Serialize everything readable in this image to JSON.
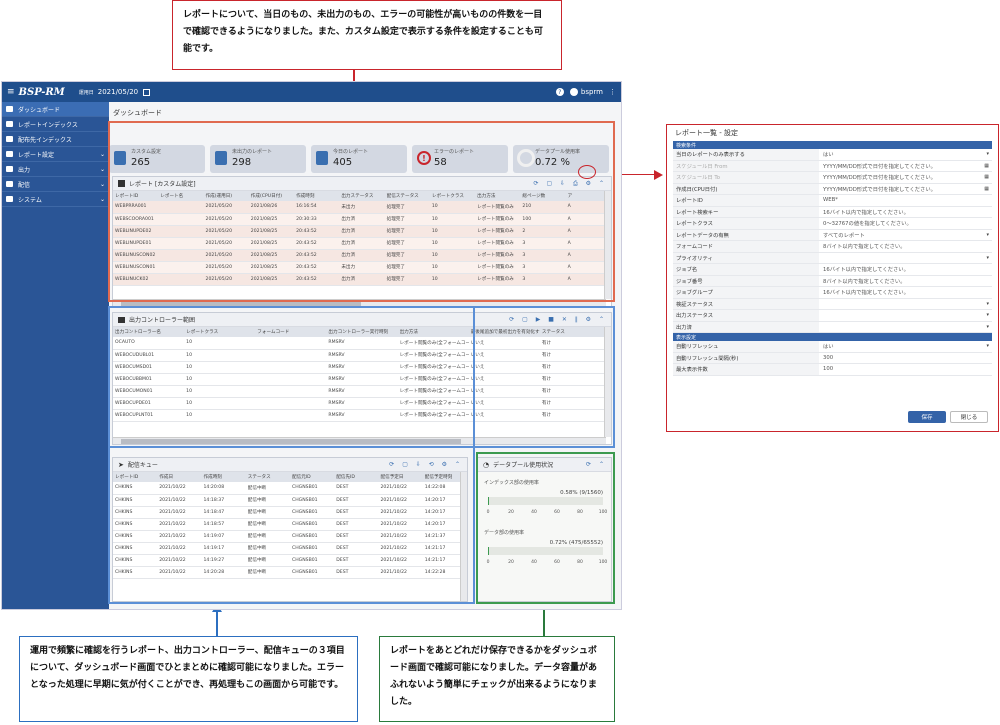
{
  "callouts": {
    "top": "レポートについて、当日のもの、未出力のもの、エラーの可能性が高いものの件数を一目で確認できるようになりました。また、カスタム設定で表示する条件を設定することも可能です。",
    "left": "運用で頻繁に確認を行うレポート、出力コントローラー、配信キューの３項目について、ダッシュボード画面でひとまとめに確認可能になりました。エラーとなった処理に早期に気が付くことができ、再処理もこの画面から可能です。",
    "right": "レポートをあとどれだけ保存できるかをダッシュボード画面で確認可能になりました。データ容量があふれないよう簡単にチェックが出来るようになりました。"
  },
  "app": {
    "logo": "BSP-RM",
    "date_label": "運用日",
    "date": "2021/05/20",
    "user": "bsprm",
    "page_title": "ダッシュボード"
  },
  "sidebar": {
    "items": [
      {
        "label": "ダッシュボード",
        "icon": "dashboard-icon"
      },
      {
        "label": "レポートインデックス",
        "icon": "report-icon"
      },
      {
        "label": "配布先インデックス",
        "icon": "book-icon"
      },
      {
        "label": "レポート設定",
        "icon": "list-icon"
      },
      {
        "label": "出力",
        "icon": "printer-icon"
      },
      {
        "label": "配信",
        "icon": "send-icon"
      },
      {
        "label": "システム",
        "icon": "monitor-icon"
      }
    ]
  },
  "cards": [
    {
      "label": "カスタム設定",
      "value": "265"
    },
    {
      "label": "未出力のレポート",
      "value": "298"
    },
    {
      "label": "今日のレポート",
      "value": "405"
    },
    {
      "label": "エラーのレポート",
      "value": "58"
    },
    {
      "label": "データプール使用率",
      "value": "0.72 %"
    }
  ],
  "report_panel": {
    "title": "レポート [カスタム設定]",
    "headers": [
      "レポートID",
      "レポート名",
      "作成(運用日)",
      "作成(CPU日付)",
      "作成時刻",
      "出力ステータス",
      "配信ステータス",
      "レポートクラス",
      "出力方法",
      "総ページ数",
      "ア"
    ],
    "rows": [
      [
        "WEBPRRA001",
        "",
        "2021/05/20",
        "2021/08/26",
        "16:16:54",
        "未出力",
        "処理完了",
        "10",
        "レポート閲覧のみ",
        "210",
        "A"
      ],
      [
        "WEBSCOORA001",
        "",
        "2021/05/20",
        "2021/08/25",
        "20:30:33",
        "出力済",
        "処理完了",
        "10",
        "レポート閲覧のみ",
        "100",
        "A"
      ],
      [
        "WEBLINUPDE02",
        "",
        "2021/05/20",
        "2021/08/25",
        "20:43:52",
        "出力済",
        "処理完了",
        "10",
        "レポート閲覧のみ",
        "2",
        "A"
      ],
      [
        "WEBLINUPDE01",
        "",
        "2021/05/20",
        "2021/08/25",
        "20:43:52",
        "出力済",
        "処理完了",
        "10",
        "レポート閲覧のみ",
        "3",
        "A"
      ],
      [
        "WEBLINUSCON02",
        "",
        "2021/05/20",
        "2021/08/25",
        "20:43:52",
        "出力済",
        "処理完了",
        "10",
        "レポート閲覧のみ",
        "3",
        "A"
      ],
      [
        "WEBLINUSCON01",
        "",
        "2021/05/20",
        "2021/08/25",
        "20:43:52",
        "未出力",
        "処理完了",
        "10",
        "レポート閲覧のみ",
        "3",
        "A"
      ],
      [
        "WEBLINUCK02",
        "",
        "2021/05/20",
        "2021/08/25",
        "20:43:52",
        "出力済",
        "処理完了",
        "10",
        "レポート閲覧のみ",
        "3",
        "A"
      ]
    ]
  },
  "output_panel": {
    "title": "出力コントローラー範囲",
    "headers": [
      "出力コントローラー名",
      "レポートクラス",
      "フォームコード",
      "出力コントローラー実行時刻",
      "出力方法",
      "最後尾追加で最初出力を有効化する",
      "ステータス"
    ],
    "rows": [
      [
        "OCAUTO",
        "10",
        "",
        "RMSRV",
        "レポート閲覧のみ(全フォームコード対象)",
        "いいえ",
        "有け"
      ],
      [
        "WEBOCUDUBL01",
        "10",
        "",
        "RMSRV",
        "レポート閲覧のみ(全フォームコード対象)",
        "いいえ",
        "有け"
      ],
      [
        "WEBOCUMSD01",
        "10",
        "",
        "RMSRV",
        "レポート閲覧のみ(全フォームコード対象)",
        "いいえ",
        "有け"
      ],
      [
        "WEBOCUBBM01",
        "10",
        "",
        "RMSRV",
        "レポート閲覧のみ(全フォームコード対象)",
        "いいえ",
        "有け"
      ],
      [
        "WEBOCUMON01",
        "10",
        "",
        "RMSRV",
        "レポート閲覧のみ(全フォームコード対象)",
        "いいえ",
        "有け"
      ],
      [
        "WEBOCUPDE01",
        "10",
        "",
        "RMSRV",
        "レポート閲覧のみ(全フォームコード対象)",
        "いいえ",
        "有け"
      ],
      [
        "WEBOCUPLNT01",
        "10",
        "",
        "RMSRV",
        "レポート閲覧のみ(全フォームコード対象)",
        "いいえ",
        "有け"
      ]
    ]
  },
  "queue_panel": {
    "title": "配信キュー",
    "headers": [
      "レポートID",
      "作成日",
      "作成時刻",
      "ステータス",
      "配信元ID",
      "配信先ID",
      "配信予定日",
      "配信予定時刻"
    ],
    "rows": [
      [
        "CHKINS",
        "2021/10/22",
        "14:20:08",
        "配信中断",
        "CHGNSB01",
        "DEST",
        "2021/10/22",
        "14:22:08"
      ],
      [
        "CHKINS",
        "2021/10/22",
        "14:18:37",
        "配信中断",
        "CHGNSB01",
        "DEST",
        "2021/10/22",
        "14:20:17"
      ],
      [
        "CHKINS",
        "2021/10/22",
        "14:18:47",
        "配信中断",
        "CHGNSB01",
        "DEST",
        "2021/10/22",
        "14:20:17"
      ],
      [
        "CHKINS",
        "2021/10/22",
        "14:18:57",
        "配信中断",
        "CHGNSB01",
        "DEST",
        "2021/10/22",
        "14:20:17"
      ],
      [
        "CHKINS",
        "2021/10/22",
        "14:19:07",
        "配信中断",
        "CHGNSB01",
        "DEST",
        "2021/10/22",
        "14:21:37"
      ],
      [
        "CHKINS",
        "2021/10/22",
        "14:19:17",
        "配信中断",
        "CHGNSB01",
        "DEST",
        "2021/10/22",
        "14:21:17"
      ],
      [
        "CHKINS",
        "2021/10/22",
        "14:19:27",
        "配信中断",
        "CHGNSB01",
        "DEST",
        "2021/10/22",
        "14:21:17"
      ],
      [
        "CHKINS",
        "2021/10/22",
        "14:20:28",
        "配信中断",
        "CHGNSB01",
        "DEST",
        "2021/10/22",
        "14:22:28"
      ]
    ]
  },
  "pool_panel": {
    "title": "データプール使用状況",
    "axis_ticks": [
      "0",
      "20",
      "40",
      "60",
      "80",
      "100"
    ],
    "gauges": [
      {
        "label": "インデックス部の使用率",
        "value_text": "0.58% (9/1560)",
        "percent": 0.58
      },
      {
        "label": "データ部の使用率",
        "value_text": "0.72% (475/65552)",
        "percent": 0.72
      }
    ]
  },
  "dialog": {
    "title": "レポート一覧 - 設定",
    "section1": "検索条件",
    "section2": "表示設定",
    "rows1": [
      {
        "label": "当日のレポートのみ表示する",
        "value": "はい",
        "dd": "▾",
        "dim": false
      },
      {
        "label": "スケジュール日 From",
        "value": "YYYY/MM/DD形式で日付を指定してください。",
        "dd": "▦",
        "dim": true
      },
      {
        "label": "スケジュール日 To",
        "value": "YYYY/MM/DD形式で日付を指定してください。",
        "dd": "▦",
        "dim": true
      },
      {
        "label": "作成日(CPU日付)",
        "value": "YYYY/MM/DD形式で日付を指定してください。",
        "dd": "▦",
        "dim": false
      },
      {
        "label": "レポートID",
        "value": "WEB*",
        "dd": "",
        "dim": false
      },
      {
        "label": "レポート検索キー",
        "value": "16バイト以内で指定してください。",
        "dd": "",
        "dim": false
      },
      {
        "label": "レポートクラス",
        "value": "0～32767の値を指定してください。",
        "dd": "",
        "dim": false
      },
      {
        "label": "レポートデータの有無",
        "value": "すべてのレポート",
        "dd": "▾",
        "dim": false
      },
      {
        "label": "フォームコード",
        "value": "8バイト以内で指定してください。",
        "dd": "",
        "dim": false
      },
      {
        "label": "プライオリティ",
        "value": "",
        "dd": "▾",
        "dim": false
      },
      {
        "label": "ジョブ名",
        "value": "16バイト以内で指定してください。",
        "dd": "",
        "dim": false
      },
      {
        "label": "ジョブ番号",
        "value": "8バイト以内で指定してください。",
        "dd": "",
        "dim": false
      },
      {
        "label": "ジョブグループ",
        "value": "16バイト以内で指定してください。",
        "dd": "",
        "dim": false
      },
      {
        "label": "検証ステータス",
        "value": "",
        "dd": "▾",
        "dim": false
      },
      {
        "label": "出力ステータス",
        "value": "",
        "dd": "▾",
        "dim": false
      },
      {
        "label": "出力済",
        "value": "",
        "dd": "▾",
        "dim": false
      }
    ],
    "rows2": [
      {
        "label": "自動リフレッシュ",
        "value": "はい",
        "dd": "▾",
        "dim": false
      },
      {
        "label": "自動リフレッシュ間隔(秒)",
        "value": "300",
        "dd": "",
        "dim": false
      },
      {
        "label": "最大表示件数",
        "value": "100",
        "dd": "",
        "dim": false
      }
    ],
    "save": "保存",
    "close": "閉じる"
  },
  "colors": {
    "red": "#c9252c",
    "blue": "#2c6fc0",
    "green": "#2a7a3c",
    "nav": "#1f4e8c"
  }
}
